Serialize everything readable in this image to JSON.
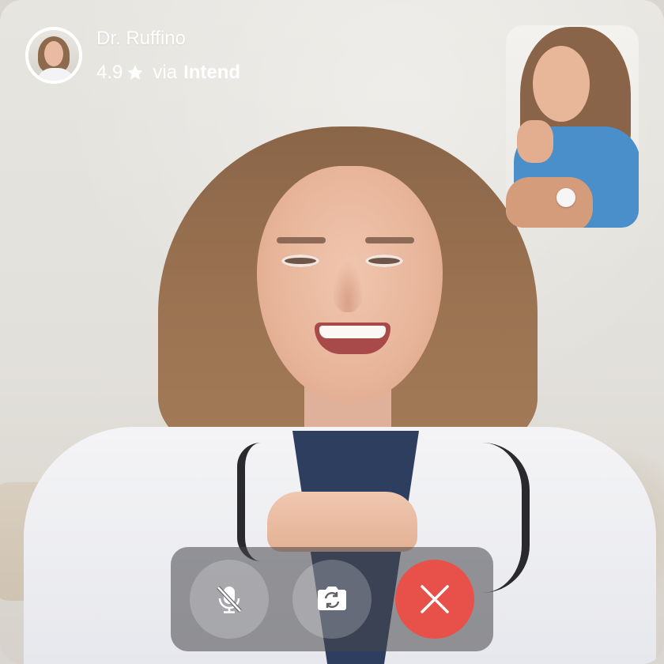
{
  "caller": {
    "name": "Dr. Ruffino",
    "rating": "4.9",
    "via_prefix": "via",
    "via_brand": "Intend"
  },
  "icons": {
    "rating": "star-icon",
    "mute": "microphone-off-icon",
    "flip_camera": "camera-switch-icon",
    "end_call": "close-icon"
  },
  "colors": {
    "end_call": "#e8514a",
    "control_bar": "#46464a",
    "text": "#ffffff"
  }
}
